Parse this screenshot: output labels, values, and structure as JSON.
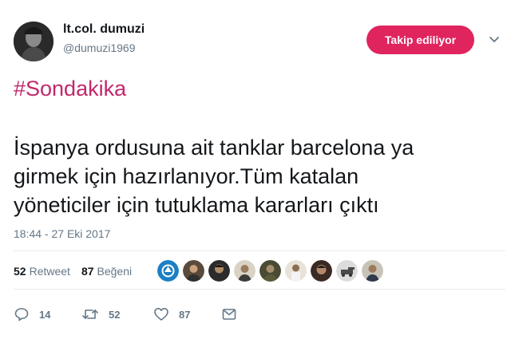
{
  "user": {
    "name": "lt.col. dumuzi",
    "handle": "@dumuzi1969"
  },
  "follow_button": {
    "label": "Takip ediliyor"
  },
  "tweet": {
    "hashtag": "#Sondakika",
    "lines": [
      "İspanya ordusuna ait tanklar barcelona ya",
      "girmek için hazırlanıyor.Tüm katalan",
      "yöneticiler için tutuklama kararları çıktı"
    ],
    "timestamp": "18:44 - 27 Eki 2017"
  },
  "stats": {
    "retweet_count": "52",
    "retweet_label": "Retweet",
    "like_count": "87",
    "like_label": "Beğeni"
  },
  "actions": {
    "reply_count": "14",
    "retweet_count": "52",
    "like_count": "87"
  },
  "colors": {
    "accent": "#e0245e",
    "hashtag": "#c2286c",
    "muted": "#657786",
    "retweet_icon": "#17bf63"
  },
  "icons": {
    "reply": "reply-icon",
    "retweet": "retweet-icon",
    "like": "heart-icon",
    "message": "message-icon",
    "menu": "chevron-down-icon"
  }
}
